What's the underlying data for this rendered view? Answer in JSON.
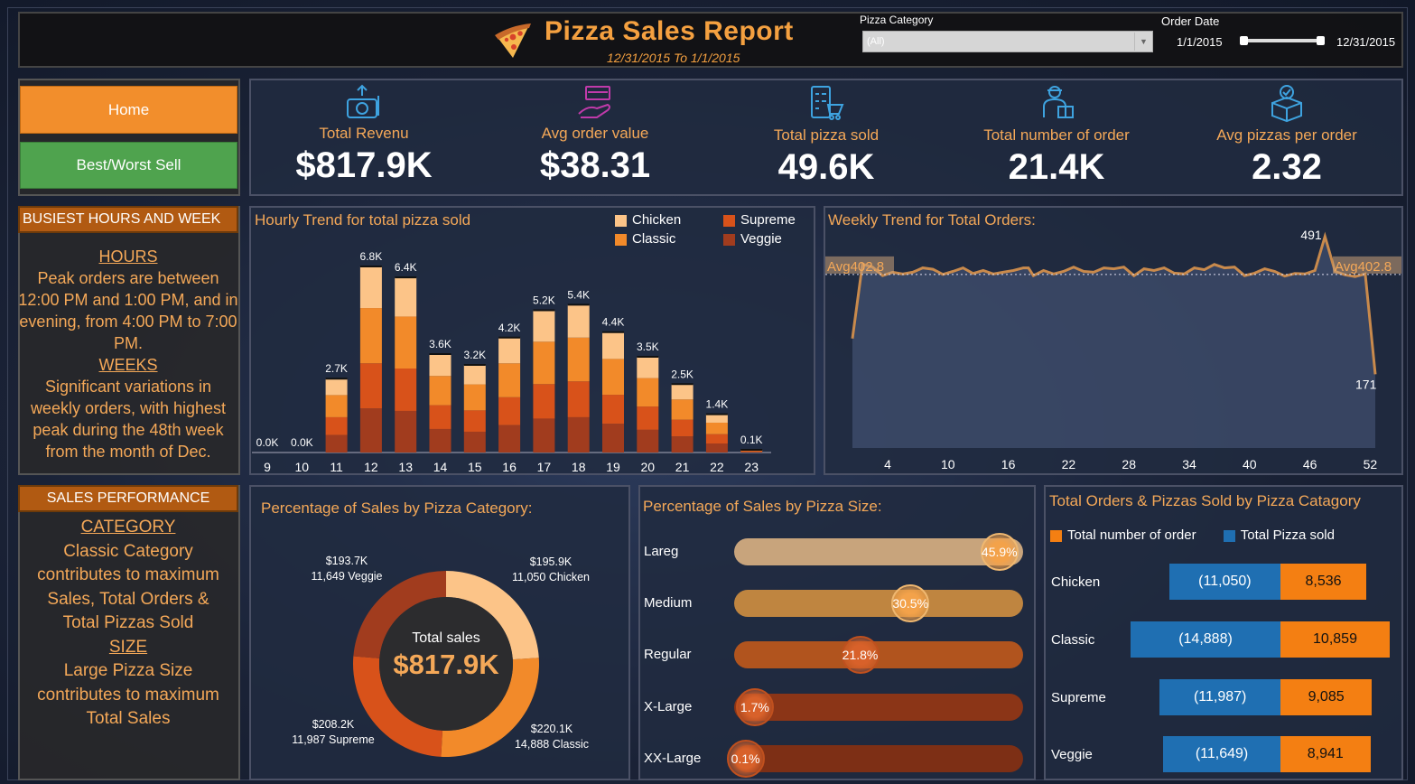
{
  "header": {
    "title": "Pizza Sales Report",
    "subtitle": "12/31/2015 To 1/1/2015",
    "filter_label": "Pizza Category",
    "filter_value": "(All)",
    "date_label": "Order Date",
    "date_start": "1/1/2015",
    "date_end": "12/31/2015"
  },
  "nav": {
    "home": "Home",
    "best_worst": "Best/Worst Sell"
  },
  "kpis": [
    {
      "label": "Total Revenu",
      "value": "$817.9K",
      "icon": "money-bag-icon"
    },
    {
      "label": "Avg order value",
      "value": "$38.31",
      "icon": "hand-box-icon"
    },
    {
      "label": "Total pizza sold",
      "value": "49.6K",
      "icon": "checklist-cart-icon"
    },
    {
      "label": "Total number of order",
      "value": "21.4K",
      "icon": "delivery-person-icon"
    },
    {
      "label": "Avg pizzas per order",
      "value": "2.32",
      "icon": "box-badge-icon"
    }
  ],
  "busiest": {
    "title": "BUSIEST HOURS AND WEEK",
    "hours_head": "HOURS",
    "hours_text": "Peak orders are between 12:00 PM and 1:00 PM, and in evening, from 4:00 PM to 7:00 PM.",
    "weeks_head": "WEEKS",
    "weeks_text": "Significant variations in weekly orders, with highest peak during the 48th week from the month of Dec."
  },
  "sales_perf": {
    "title": "SALES PERFORMANCE",
    "cat_head": "CATEGORY",
    "cat_text": "Classic Category contributes to maximum Sales, Total Orders & Total Pizzas Sold",
    "size_head": "SIZE",
    "size_text": "Large Pizza Size contributes to maximum Total Sales"
  },
  "hourly": {
    "title": "Hourly Trend for total pizza sold",
    "legend": [
      {
        "name": "Chicken",
        "color": "#fcc488"
      },
      {
        "name": "Supreme",
        "color": "#d8521a"
      },
      {
        "name": "Classic",
        "color": "#f28a2a"
      },
      {
        "name": "Veggie",
        "color": "#a13c1e"
      }
    ]
  },
  "weekly": {
    "title": "Weekly Trend for Total Orders:",
    "avg_label": "Avg402.8",
    "max_label": "491",
    "min_label": "171"
  },
  "pie": {
    "title": "Percentage of Sales by Pizza Category:",
    "center_label": "Total sales",
    "center_value": "$817.9K",
    "labels": [
      {
        "amount": "$195.9K",
        "count": "11,050",
        "name": "Chicken"
      },
      {
        "amount": "$220.1K",
        "count": "14,888",
        "name": "Classic"
      },
      {
        "amount": "$208.2K",
        "count": "11,987",
        "name": "Supreme"
      },
      {
        "amount": "$193.7K",
        "count": "11,649",
        "name": "Veggie"
      }
    ]
  },
  "sizes": {
    "title": "Percentage of Sales by Pizza Size:",
    "items": [
      {
        "name": "Lareg",
        "pct": "45.9%",
        "value": 45.9,
        "color": "#c8a47c"
      },
      {
        "name": "Medium",
        "pct": "30.5%",
        "value": 30.5,
        "color": "#bf8540"
      },
      {
        "name": "Regular",
        "pct": "21.8%",
        "value": 21.8,
        "color": "#b1541e"
      },
      {
        "name": "X-Large",
        "pct": "1.7%",
        "value": 1.7,
        "color": "#8b3517"
      },
      {
        "name": "XX-Large",
        "pct": "0.1%",
        "value": 0.1,
        "color": "#7d2f15"
      }
    ]
  },
  "orders_cat": {
    "title": "Total Orders & Pizzas Sold by Pizza Catagory",
    "legend_orders": "Total number of order",
    "legend_pizzas": "Total Pizza sold",
    "rows": [
      {
        "name": "Chicken",
        "pizzas_label": "(11,050)",
        "orders_label": "8,536",
        "pizzas": 11050,
        "orders": 8536
      },
      {
        "name": "Classic",
        "pizzas_label": "(14,888)",
        "orders_label": "10,859",
        "pizzas": 14888,
        "orders": 10859
      },
      {
        "name": "Supreme",
        "pizzas_label": "(11,987)",
        "orders_label": "9,085",
        "pizzas": 11987,
        "orders": 9085
      },
      {
        "name": "Veggie",
        "pizzas_label": "(11,649)",
        "orders_label": "8,941",
        "pizzas": 11649,
        "orders": 8941
      }
    ]
  },
  "chart_data": [
    {
      "type": "bar",
      "title": "Hourly Trend for total pizza sold",
      "stacked": true,
      "categories": [
        "9",
        "10",
        "11",
        "12",
        "13",
        "14",
        "15",
        "16",
        "17",
        "18",
        "19",
        "20",
        "21",
        "22",
        "23"
      ],
      "totals_labels": [
        "0.0K",
        "0.0K",
        "2.7K",
        "6.8K",
        "6.4K",
        "3.6K",
        "3.2K",
        "4.2K",
        "5.2K",
        "5.4K",
        "4.4K",
        "3.5K",
        "2.5K",
        "1.4K",
        "0.1K"
      ],
      "series": [
        {
          "name": "Veggie",
          "values": [
            0,
            0,
            640,
            1610,
            1520,
            860,
            760,
            1000,
            1240,
            1290,
            1050,
            830,
            590,
            330,
            25
          ]
        },
        {
          "name": "Supreme",
          "values": [
            0,
            0,
            650,
            1650,
            1550,
            870,
            780,
            1020,
            1260,
            1310,
            1060,
            850,
            610,
            340,
            25
          ]
        },
        {
          "name": "Classic",
          "values": [
            0,
            0,
            810,
            2020,
            1900,
            1070,
            950,
            1240,
            1550,
            1600,
            1310,
            1040,
            740,
            420,
            30
          ]
        },
        {
          "name": "Chicken",
          "values": [
            0,
            0,
            600,
            1520,
            1430,
            800,
            710,
            940,
            1150,
            1200,
            980,
            780,
            560,
            310,
            20
          ]
        }
      ],
      "legend_position": "top-right"
    },
    {
      "type": "area",
      "title": "Weekly Trend for Total Orders:",
      "x_ticks": [
        4,
        10,
        16,
        22,
        28,
        34,
        40,
        46,
        52
      ],
      "x": [
        1,
        2,
        3,
        4,
        5,
        6,
        7,
        8,
        9,
        10,
        11,
        12,
        13,
        14,
        15,
        16,
        17,
        18,
        18.5,
        19,
        20,
        21,
        22,
        23,
        24,
        25,
        26,
        27,
        28,
        29,
        30,
        31,
        32,
        33,
        34,
        35,
        36,
        37,
        38,
        39,
        40,
        41,
        42,
        43,
        44,
        45,
        46,
        47,
        48,
        49,
        50,
        51,
        52,
        53
      ],
      "y": [
        254,
        427,
        420,
        400,
        408,
        404,
        408,
        418,
        415,
        403,
        410,
        418,
        405,
        412,
        404,
        408,
        412,
        418,
        418,
        400,
        412,
        404,
        410,
        420,
        410,
        408,
        418,
        416,
        420,
        400,
        416,
        412,
        418,
        406,
        404,
        418,
        414,
        426,
        418,
        420,
        400,
        406,
        416,
        410,
        399,
        405,
        404,
        412,
        491,
        410,
        402,
        398,
        404,
        171
      ],
      "avg": 402.8,
      "ylim": [
        0,
        520
      ],
      "labels": {
        "max": "491",
        "min": "171",
        "avg": "Avg402.8"
      }
    },
    {
      "type": "pie",
      "title": "Percentage of Sales by Pizza Category:",
      "donut": true,
      "slices": [
        {
          "name": "Chicken",
          "value": 195.9,
          "color": "#fcc488"
        },
        {
          "name": "Classic",
          "value": 220.1,
          "color": "#f28a2a"
        },
        {
          "name": "Supreme",
          "value": 208.2,
          "color": "#d8521a"
        },
        {
          "name": "Veggie",
          "value": 193.7,
          "color": "#a13c1e"
        }
      ]
    },
    {
      "type": "bar",
      "title": "Percentage of Sales by Pizza Size:",
      "categories": [
        "Lareg",
        "Medium",
        "Regular",
        "X-Large",
        "XX-Large"
      ],
      "values": [
        45.9,
        30.5,
        21.8,
        1.7,
        0.1
      ]
    },
    {
      "type": "bar",
      "title": "Total Orders & Pizzas Sold by Pizza Catagory",
      "orientation": "horizontal",
      "categories": [
        "Chicken",
        "Classic",
        "Supreme",
        "Veggie"
      ],
      "series": [
        {
          "name": "Total Pizza sold",
          "values": [
            11050,
            14888,
            11987,
            11649
          ],
          "color": "#1f6fb2"
        },
        {
          "name": "Total number of order",
          "values": [
            8536,
            10859,
            9085,
            8941
          ],
          "color": "#f47f12"
        }
      ]
    }
  ]
}
